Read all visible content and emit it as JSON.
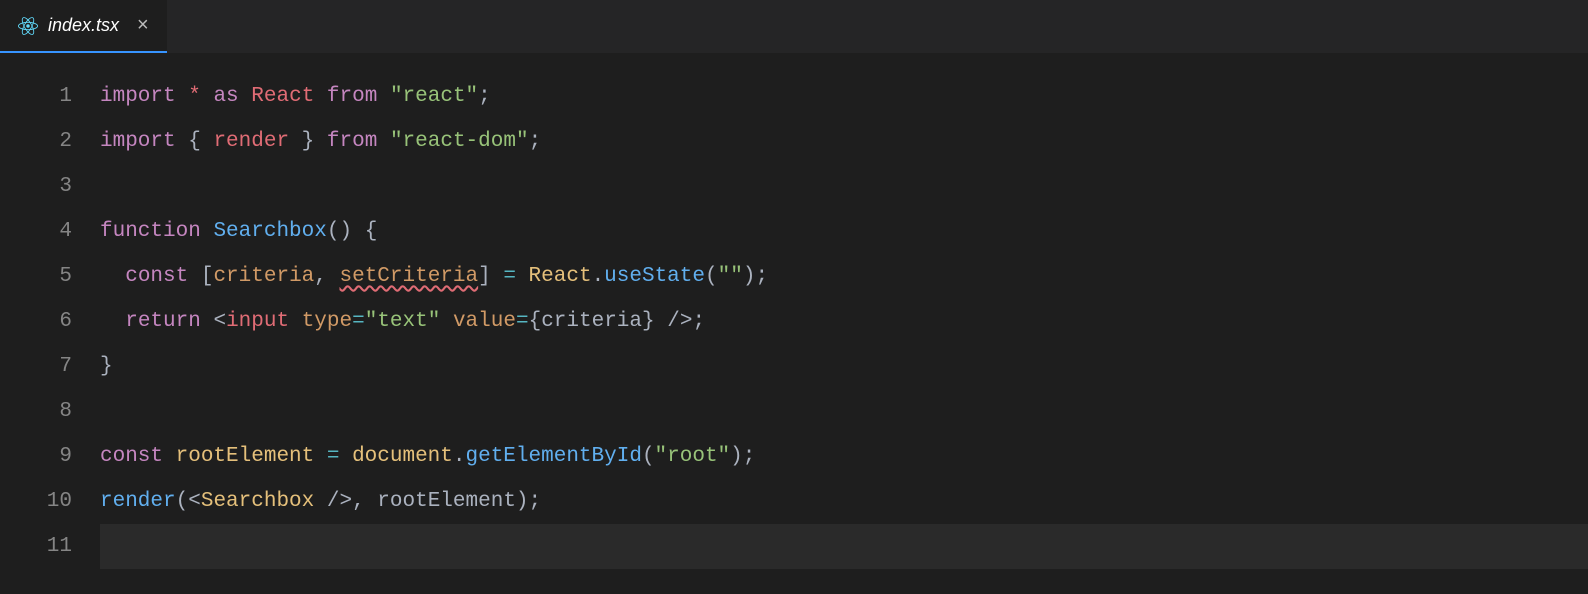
{
  "tab": {
    "filename": "index.tsx",
    "close": "×"
  },
  "gutter": [
    "1",
    "2",
    "3",
    "4",
    "5",
    "6",
    "7",
    "8",
    "9",
    "10",
    "11"
  ],
  "code": {
    "l1": {
      "import": "import",
      "star": "*",
      "as": "as",
      "react": "React",
      "from": "from",
      "str": "\"react\"",
      "semi": ";"
    },
    "l2": {
      "import": "import",
      "ob": "{ ",
      "render": "render",
      "cb": " }",
      "from": "from",
      "str": "\"react-dom\"",
      "semi": ";"
    },
    "l4": {
      "fn": "function",
      "name": "Searchbox",
      "paren": "()",
      "brace": "{"
    },
    "l5": {
      "const": "const",
      "ob": "[",
      "c1": "criteria",
      "comma": ", ",
      "c2": "setCriteria",
      "cb": "]",
      "eq": " = ",
      "react": "React",
      "dot": ".",
      "use": "useState",
      "op": "(",
      "str": "\"\"",
      "cp": ")",
      "semi": ";"
    },
    "l6": {
      "ret": "return",
      "lt": "<",
      "tag": "input",
      "a1": "type",
      "eq1": "=",
      "v1": "\"text\"",
      "a2": "value",
      "eq2": "=",
      "ob": "{",
      "val": "criteria",
      "cb": "}",
      "gt": " />",
      "semi": ";"
    },
    "l7": {
      "brace": "}"
    },
    "l9": {
      "const": "const",
      "name": "rootElement",
      "eq": " = ",
      "doc": "document",
      "dot": ".",
      "fn": "getElementById",
      "op": "(",
      "str": "\"root\"",
      "cp": ")",
      "semi": ";"
    },
    "l10": {
      "render": "render",
      "op": "(",
      "lt": "<",
      "tag": "Searchbox",
      "gt": " />",
      "comma": ", ",
      "arg": "rootElement",
      "cp": ")",
      "semi": ";"
    }
  }
}
